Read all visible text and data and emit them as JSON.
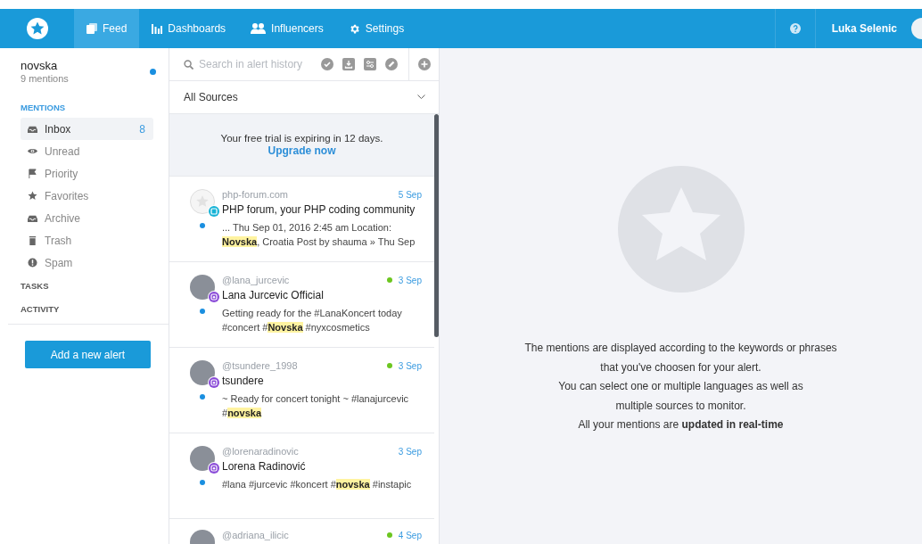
{
  "nav": {
    "tabs": [
      {
        "label": "Feed",
        "selected": true
      },
      {
        "label": "Dashboards",
        "selected": false
      },
      {
        "label": "Influencers",
        "selected": false
      },
      {
        "label": "Settings",
        "selected": false
      }
    ],
    "user": "Luka Selenic"
  },
  "sidebar": {
    "alert": {
      "name": "novska",
      "count": "9 mentions",
      "unread": true
    },
    "section": "MENTIONS",
    "items": [
      {
        "label": "Inbox",
        "count": "8",
        "selected": true
      },
      {
        "label": "Unread",
        "selected": false
      },
      {
        "label": "Priority",
        "selected": false
      },
      {
        "label": "Favorites",
        "selected": false
      },
      {
        "label": "Archive",
        "selected": false
      },
      {
        "label": "Trash",
        "selected": false
      },
      {
        "label": "Spam",
        "selected": false
      }
    ],
    "sections": [
      "TASKS",
      "ACTIVITY"
    ],
    "add_button": "Add a new alert"
  },
  "feed": {
    "search": {
      "placeholder": "Search in alert history"
    },
    "sources": "All Sources",
    "trial": {
      "text": "Your free trial is expiring in 12 days.",
      "link": "Upgrade now"
    },
    "mentions": [
      {
        "source": "php-forum.com",
        "kind": "forum",
        "date": "5 Sep",
        "online": false,
        "unread": true,
        "title": "PHP forum, your PHP coding community",
        "body": [
          {
            "text": "... Thu Sep 01, 2016 2:45 am Location: ",
            "highlight": false
          },
          {
            "text": "Novska",
            "highlight": true
          },
          {
            "text": ", Croatia Post by shauma » Thu Sep",
            "highlight": false
          }
        ]
      },
      {
        "source": "@lana_jurcevic",
        "kind": "instagram",
        "date": "3 Sep",
        "online": true,
        "unread": true,
        "title": "Lana Jurcevic Official",
        "body": [
          {
            "text": "Getting ready for the #LanaKoncert today #concert #",
            "highlight": false
          },
          {
            "text": "Novska",
            "highlight": true
          },
          {
            "text": " #nyxcosmetics",
            "highlight": false
          }
        ]
      },
      {
        "source": "@tsundere_1998",
        "kind": "instagram",
        "date": "3 Sep",
        "online": true,
        "unread": true,
        "title": "tsundere",
        "body": [
          {
            "text": "~ Ready for concert tonight ~ #lanajurcevic #",
            "highlight": false
          },
          {
            "text": "novska",
            "highlight": true
          }
        ]
      },
      {
        "source": "@lorenaradinovic",
        "kind": "instagram",
        "date": "3 Sep",
        "online": false,
        "unread": true,
        "title": "Lorena Radinović",
        "body": [
          {
            "text": "#lana #jurcevic #koncert #",
            "highlight": false
          },
          {
            "text": "novska",
            "highlight": true
          },
          {
            "text": " #instapic",
            "highlight": false
          }
        ]
      },
      {
        "source": "@adriana_ilicic",
        "kind": "instagram",
        "date": "4 Sep",
        "online": true
      }
    ]
  },
  "empty_state": {
    "lines": [
      "The mentions are displayed according to the keywords or phrases",
      "that you've choosen for your alert.",
      "You can select one or multiple languages as well as",
      "multiple sources to monitor.",
      "All your mentions are **updated in real-time**"
    ]
  }
}
